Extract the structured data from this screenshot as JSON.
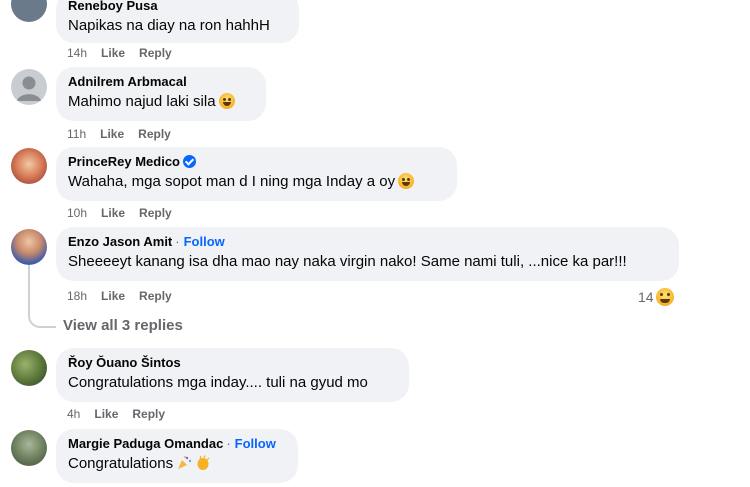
{
  "comments": [
    {
      "name": "Reneboy Pusa",
      "text": "Napikas na diay na ron hahhH",
      "time": "14h",
      "like": "Like",
      "reply": "Reply"
    },
    {
      "name": "Adnilrem Arbmacal",
      "text": "Mahimo najud laki sila",
      "time": "11h",
      "like": "Like",
      "reply": "Reply"
    },
    {
      "name": "PrinceRey Medico",
      "text": "Wahaha, mga sopot man d I ning mga Inday a oy",
      "time": "10h",
      "like": "Like",
      "reply": "Reply"
    },
    {
      "name": "Enzo Jason Amit",
      "follow": "Follow",
      "separator": "·",
      "text": "Sheeeeyt kanang isa dha mao nay naka virgin nako! Same nami tuli, ...nice ka par!!!",
      "time": "18h",
      "like": "Like",
      "reply": "Reply",
      "reaction_count": "14"
    },
    {
      "name": "Řoy Ŏuano Šintos",
      "text": "Congratulations mga inday.... tuli na gyud mo",
      "time": "4h",
      "like": "Like",
      "reply": "Reply"
    },
    {
      "name": "Margie Paduga Omandac",
      "follow": "Follow",
      "separator": "·",
      "text": "Congratulations"
    }
  ],
  "view_replies": "View all 3 replies",
  "colors": {
    "bubble": "#f0f2f5",
    "follow": "#0866ff",
    "meta": "#65676b"
  }
}
